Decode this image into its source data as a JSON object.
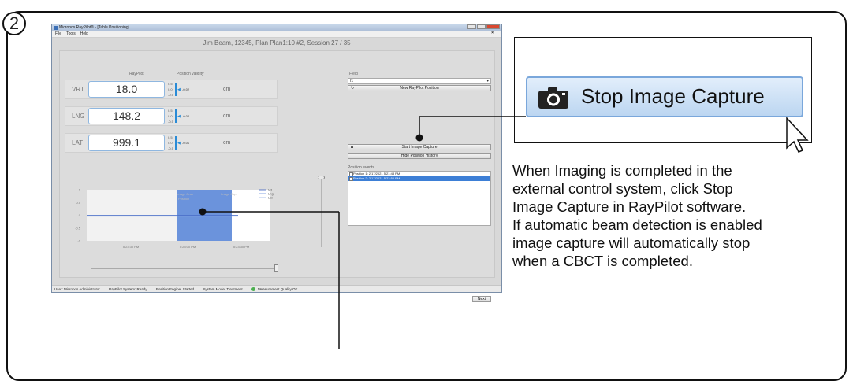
{
  "step": "2",
  "window": {
    "title": "Micropos RayPilot® - [Table Positioning]",
    "menu": [
      "File",
      "Tools",
      "Help"
    ],
    "close_glyph": "×",
    "header": "Jim Beam, 12345, Plan Plan1:10 #2, Session 27 / 35",
    "col_raypilot": "RayPilot",
    "col_validity": "Position validity",
    "axes": [
      {
        "label": "VRT",
        "value": "18.0",
        "delta": "-0.02",
        "unit": "cm",
        "top": "0.5",
        "mid": "0.0",
        "bottom": "-0.5"
      },
      {
        "label": "LNG",
        "value": "148.2",
        "delta": "-0.02",
        "unit": "cm",
        "top": "0.5",
        "mid": "0.0",
        "bottom": "-0.5"
      },
      {
        "label": "LAT",
        "value": "999.1",
        "delta": "-0.01",
        "unit": "cm",
        "top": "0.5",
        "mid": "0.0",
        "bottom": "-0.5"
      }
    ],
    "field_label": "Field",
    "field_value": "f1",
    "new_position_button": "New RayPilot Position",
    "image_capture_button": "Start Image Capture",
    "hide_history_button": "Hide Position History",
    "position_events_label": "Position events",
    "position_events": [
      {
        "text": "Position 1: 2/17/2021 5:21:48 PM",
        "selected": false
      },
      {
        "text": "Position 2: 2/17/2021 5:22:56 PM",
        "selected": true
      }
    ],
    "next_button": "Next",
    "status": {
      "user": "User: Micropos Administrator",
      "system": "RayPilot System: Ready",
      "engine": "Position Engine: Started",
      "mode": "System Mode: Treatment",
      "quality": "Measurement Quality OK"
    }
  },
  "chart_data": {
    "type": "line",
    "x_ticks": [
      "5:23:30 PM",
      "5:23:00 PM",
      "5:23:30 PM"
    ],
    "y_ticks": [
      "1",
      "0.5",
      "0",
      "-0.5",
      "-1"
    ],
    "ylim": [
      -1,
      1
    ],
    "shaded_region_labels": [
      "Image Grab",
      "Position"
    ],
    "shaded_region_right_label": "Image Cap",
    "series": [
      {
        "name": "Vrt",
        "color": "#3b5fc0",
        "values": [
          0,
          0,
          0,
          0,
          0,
          0,
          0
        ]
      },
      {
        "name": "Lng",
        "color": "#6a8fdc",
        "values": [
          0,
          0,
          0,
          0,
          0,
          0,
          0
        ]
      },
      {
        "name": "Lat",
        "color": "#9bb4e6",
        "values": [
          0,
          0,
          0,
          0,
          0,
          0,
          0
        ]
      }
    ]
  },
  "callout": {
    "button_label": "Stop Image Capture",
    "icon": "camera-icon",
    "description": [
      "When Imaging is completed in the",
      "external control system, click Stop",
      "Image Capture in RayPilot software.",
      "If automatic beam detection is enabled",
      "image capture will automatically stop",
      "when a CBCT is completed."
    ]
  },
  "colors": {
    "accent_blue": "#2a8bd6",
    "capture_region": "#6b93dc",
    "selected_row": "#3d7fd6"
  }
}
